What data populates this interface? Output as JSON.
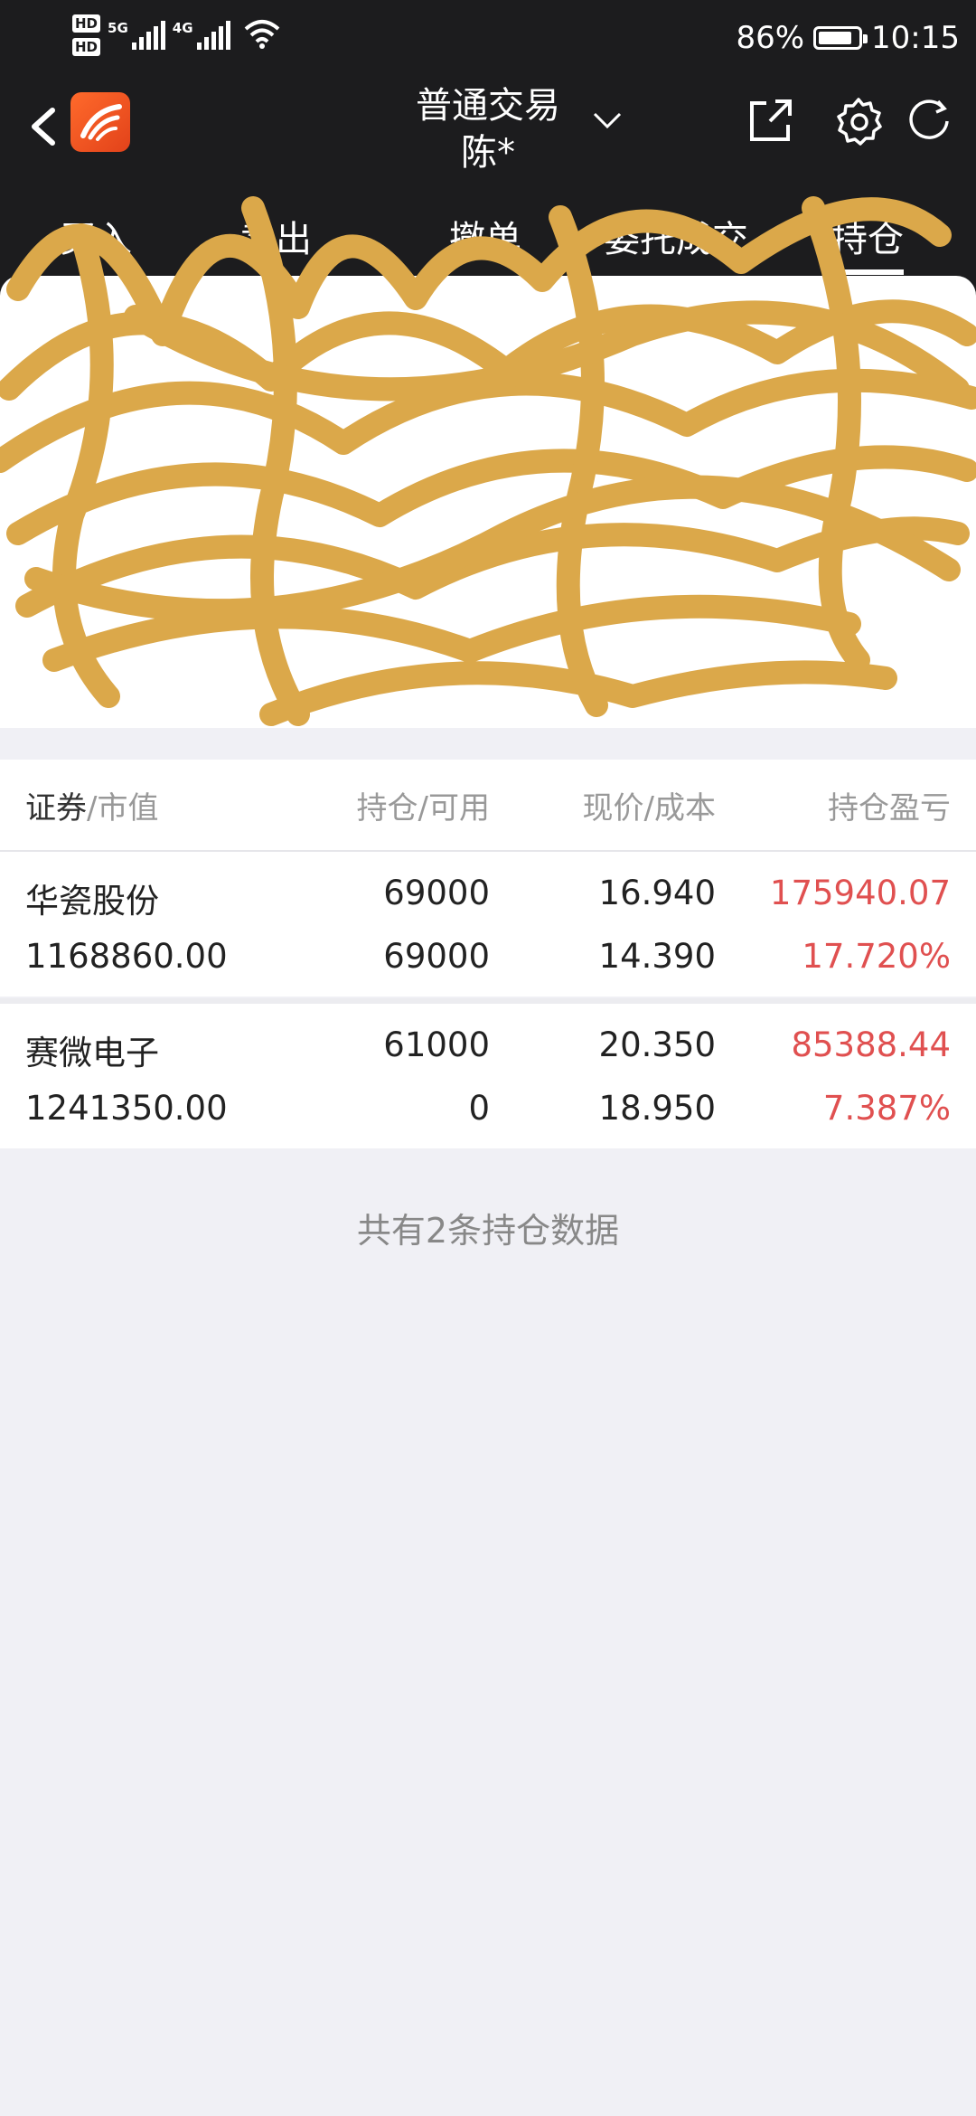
{
  "status_bar": {
    "hd1": "HD",
    "hd2": "HD",
    "net1": "5G",
    "net2": "4G",
    "battery_percent": "86%",
    "battery_level": 0.86,
    "time": "10:15"
  },
  "header": {
    "title": "普通交易",
    "subtitle": "陈*"
  },
  "tabs": [
    {
      "label": "买入"
    },
    {
      "label": "卖出"
    },
    {
      "label": "撤单"
    },
    {
      "label": "委托成交"
    },
    {
      "label": "持仓"
    }
  ],
  "table": {
    "headers": {
      "col1_main": "证券",
      "col1_sub": "/市值",
      "col2": "持仓/可用",
      "col3": "现价/成本",
      "col4": "持仓盈亏"
    },
    "rows": [
      {
        "name": "华瓷股份",
        "market_value": "1168860.00",
        "holding": "69000",
        "available": "69000",
        "price": "16.940",
        "cost": "14.390",
        "pnl": "175940.07",
        "pnl_pct": "17.720%"
      },
      {
        "name": "赛微电子",
        "market_value": "1241350.00",
        "holding": "61000",
        "available": "0",
        "price": "20.350",
        "cost": "18.950",
        "pnl": "85388.44",
        "pnl_pct": "7.387%"
      }
    ]
  },
  "footer_note": "共有2条持仓数据",
  "colors": {
    "dark_bg": "#1c1c1e",
    "profit_red": "#e05050",
    "scribble": "#dba84a",
    "page_bg": "#f0f0f5"
  },
  "icons": [
    "back-arrow-icon",
    "app-logo",
    "chevron-down-icon",
    "export-icon",
    "gear-icon",
    "refresh-icon",
    "signal-icon",
    "wifi-icon",
    "battery-icon"
  ]
}
